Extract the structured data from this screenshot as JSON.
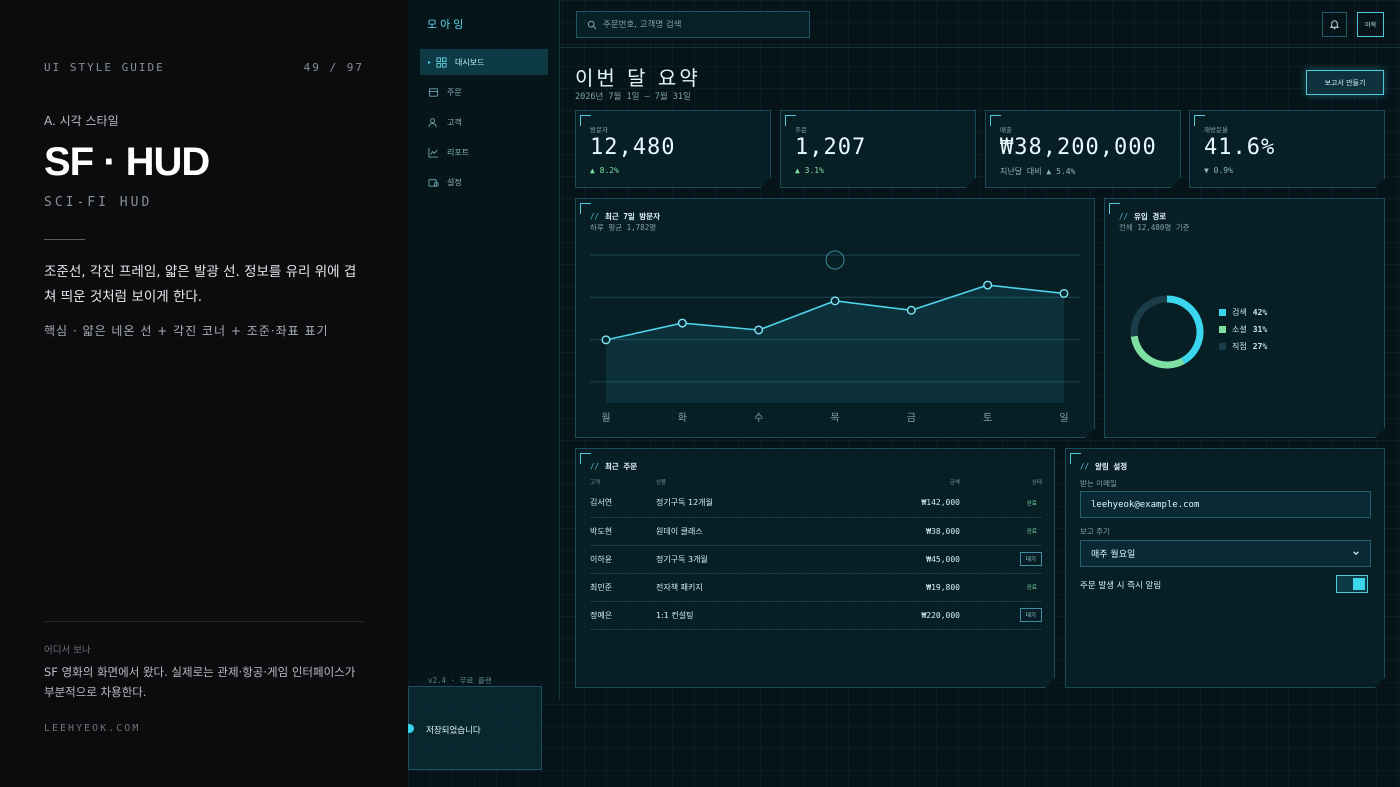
{
  "guide": {
    "header_left": "UI STYLE GUIDE",
    "page_count": "49 / 97",
    "section": "A. 시각 스타일",
    "title": "SF · HUD",
    "subtitle": "SCI-FI HUD",
    "description": "조준선, 각진 프레임, 얇은 발광 선. 정보를 유리 위에 겹쳐 띄운 것처럼 보이게 한다.",
    "core": "핵심 · 얇은 네온 선 + 각진 코너 + 조준·좌표 표기",
    "source_label": "어디서 보나",
    "source_text": "SF 영화의 화면에서 왔다. 실제로는 관제·항공·게임 인터페이스가 부분적으로 차용한다.",
    "site": "LEEHYEOK.COM"
  },
  "app": {
    "brand": "모아잉",
    "nav": [
      {
        "label": "대시보드",
        "icon": "grid-icon",
        "active": true
      },
      {
        "label": "주문",
        "icon": "box-icon"
      },
      {
        "label": "고객",
        "icon": "user-icon"
      },
      {
        "label": "리포트",
        "icon": "chart-icon"
      },
      {
        "label": "설정",
        "icon": "settings-icon"
      }
    ],
    "version": "v2.4 · 무료 플랜",
    "search_placeholder": "주문번호, 고객명 검색",
    "avatar": "이혁",
    "page_title": "이번 달 요약",
    "date_range": "2026년 7월 1일 — 7월 31일",
    "report_button": "보고서 만들기",
    "kpis": [
      {
        "label": "방문자",
        "value": "12,480",
        "delta": "▲ 8.2%"
      },
      {
        "label": "주문",
        "value": "1,207",
        "delta": "▲ 3.1%"
      },
      {
        "label": "매출",
        "value": "₩38,200,000",
        "delta": "지난달 대비 ▲ 5.4%"
      },
      {
        "label": "재방문율",
        "value": "41.6%",
        "delta": "▼ 0.9%"
      }
    ],
    "visitors_panel": {
      "title": "최근 7일 방문자",
      "subtitle": "하루 평균 1,782명"
    },
    "sources_panel": {
      "title": "유입 경로",
      "subtitle": "전체 12,480명 기준"
    },
    "orders_panel": {
      "title": "최근 주문",
      "columns": [
        "고객",
        "상품",
        "금액",
        "상태"
      ],
      "rows": [
        {
          "customer": "김서연",
          "product": "정기구독 12개월",
          "amount": "₩142,000",
          "status": "완료"
        },
        {
          "customer": "박도현",
          "product": "원데이 클래스",
          "amount": "₩38,000",
          "status": "완료"
        },
        {
          "customer": "이하윤",
          "product": "정기구독 3개월",
          "amount": "₩45,000",
          "status": "대기"
        },
        {
          "customer": "최민준",
          "product": "전자책 패키지",
          "amount": "₩19,800",
          "status": "완료"
        },
        {
          "customer": "정예은",
          "product": "1:1 컨설팅",
          "amount": "₩220,000",
          "status": "대기"
        }
      ]
    },
    "alerts_panel": {
      "title": "알림 설정",
      "email_label": "받는 이메일",
      "email_value": "leehyeok@example.com",
      "period_label": "보고 주기",
      "period_value": "매주 월요일",
      "toggle_label": "주문 발생 시 즉시 알림",
      "toggle_on": true
    },
    "toast": "저장되었습니다",
    "colors": {
      "accent": "#39d6ee",
      "green": "#7fe0a3",
      "dark": "#1b3d4a"
    }
  },
  "chart_data": [
    {
      "type": "area",
      "categories": [
        "월",
        "화",
        "수",
        "목",
        "금",
        "토",
        "일"
      ],
      "values": [
        1280,
        1620,
        1480,
        2070,
        1880,
        2390,
        2220
      ],
      "ylim": [
        0,
        3000
      ],
      "grid": true
    },
    {
      "type": "pie",
      "labels": [
        "검색",
        "소셜",
        "직접"
      ],
      "values": [
        42,
        31,
        27
      ],
      "colors": [
        "#39d6ee",
        "#7fe0a3",
        "#1b3d4a"
      ],
      "legend": "right"
    }
  ]
}
